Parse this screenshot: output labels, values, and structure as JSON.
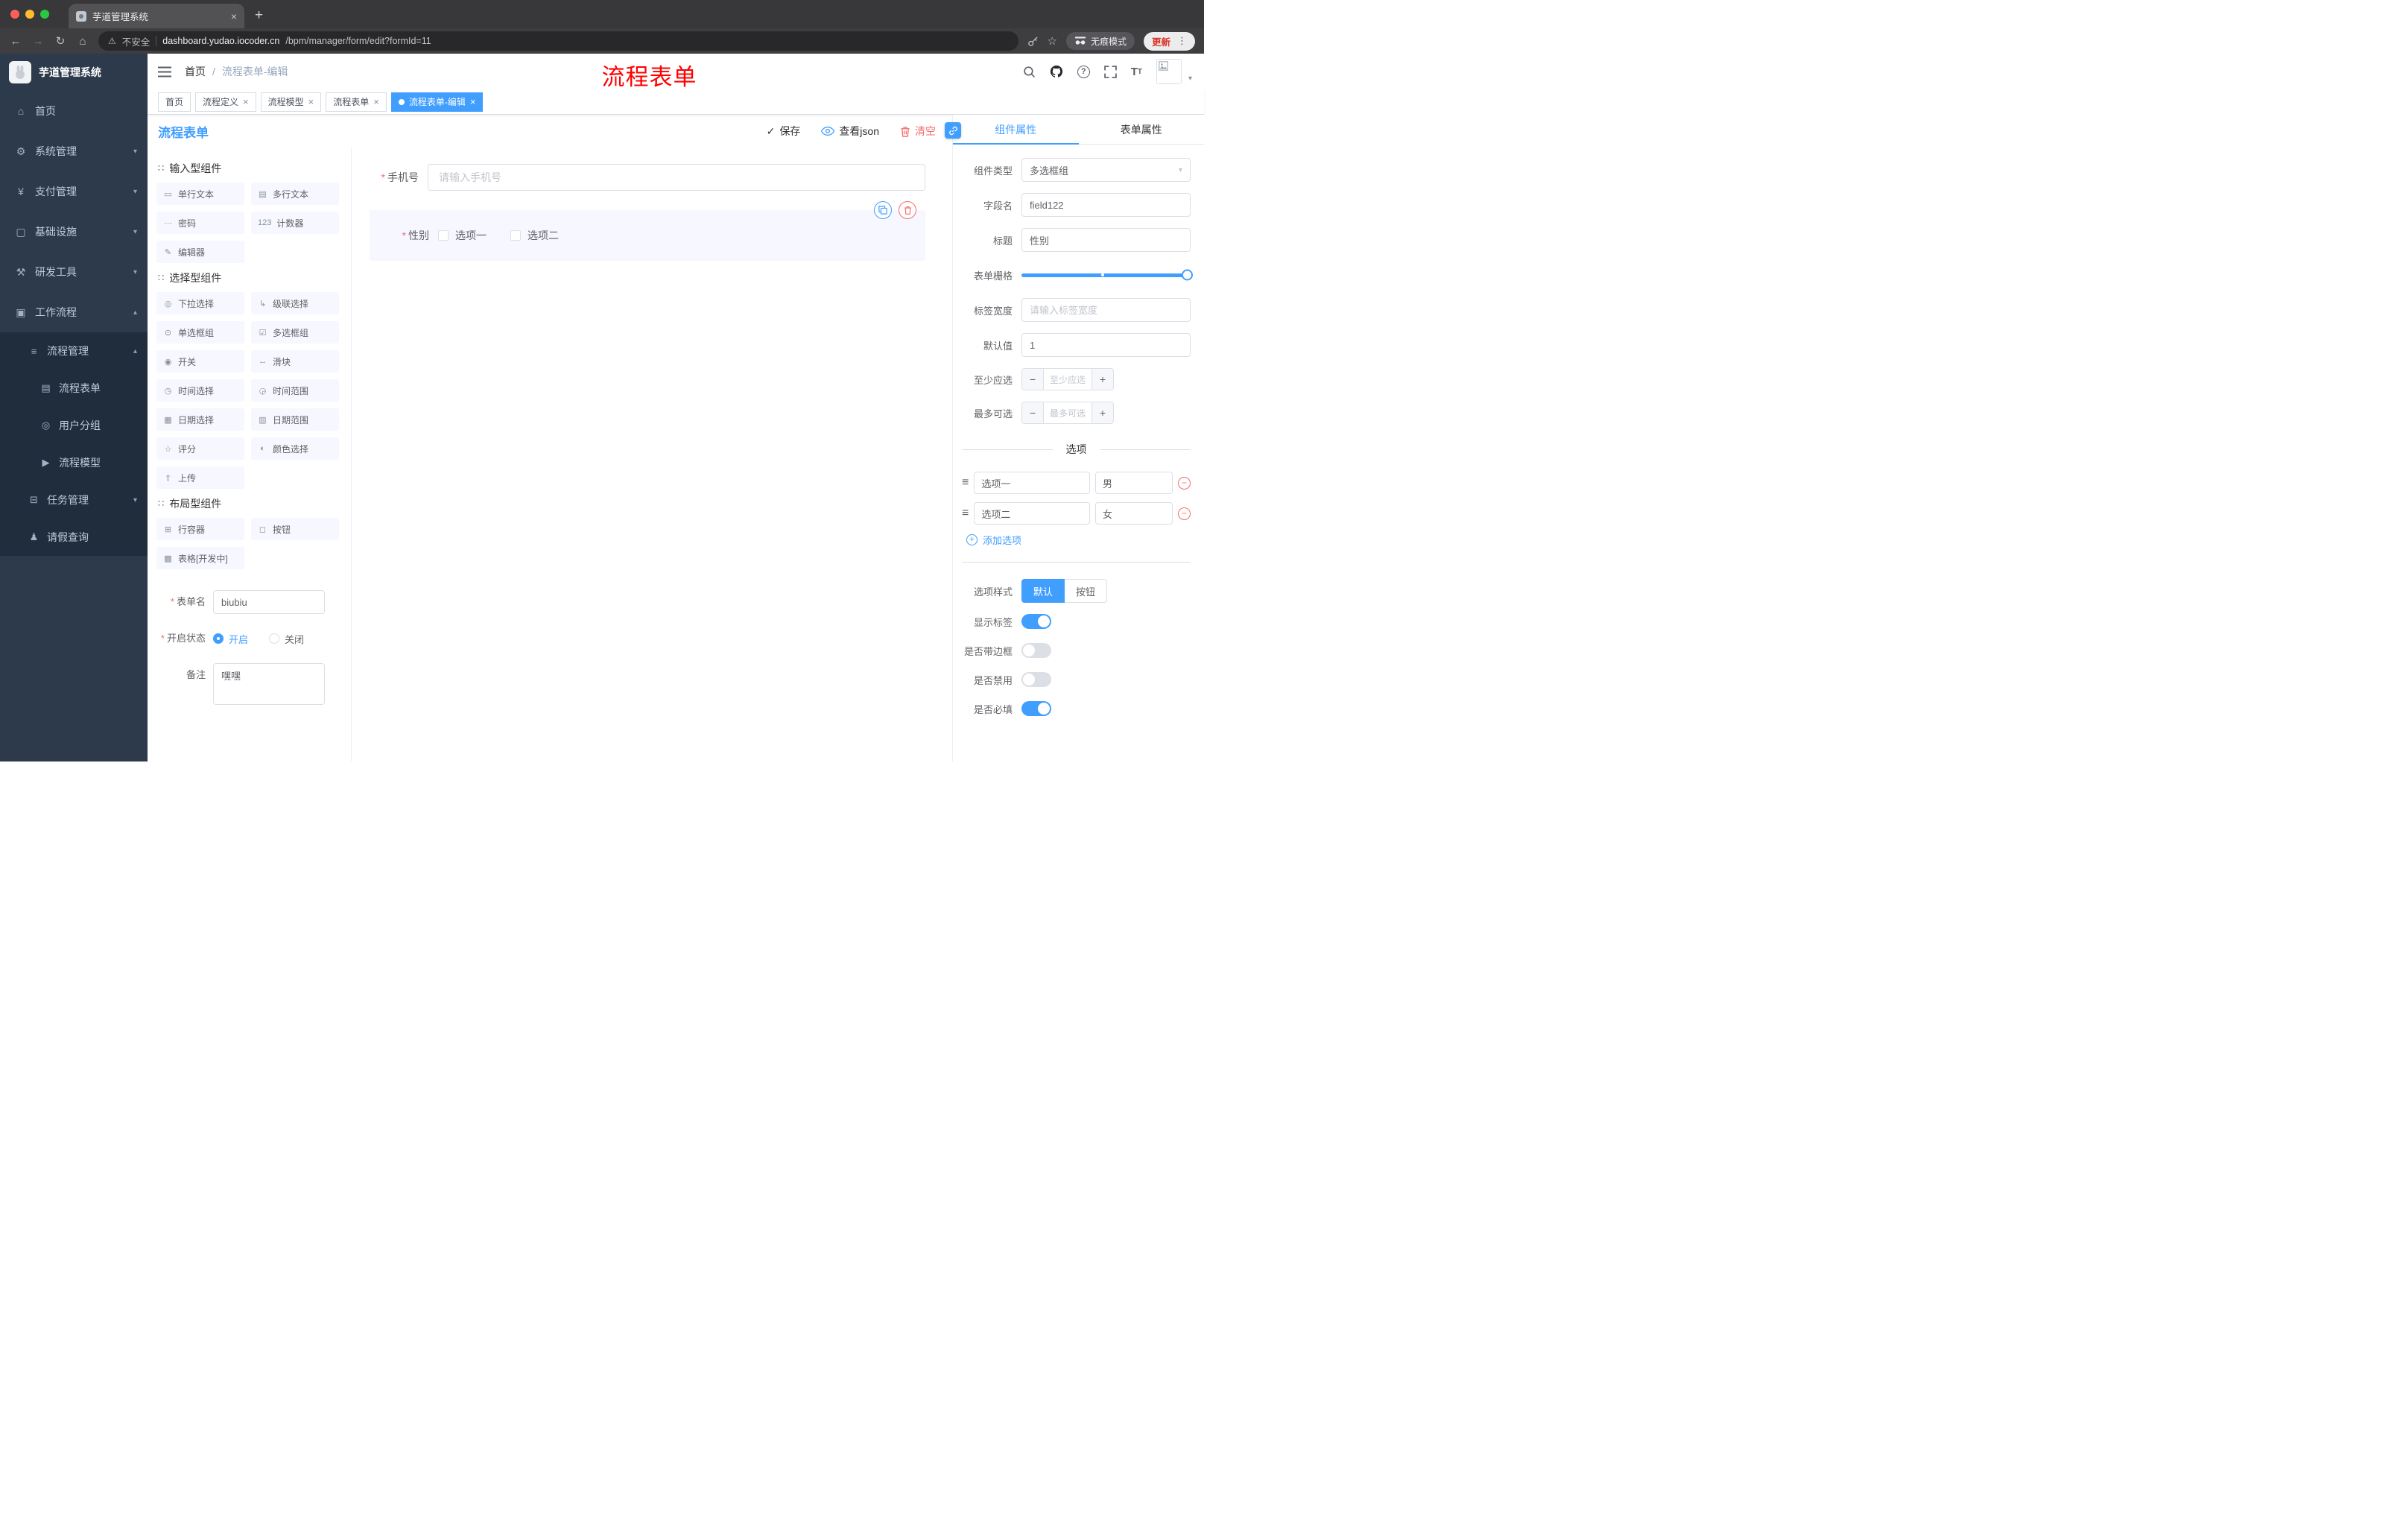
{
  "colors": {
    "primary": "#409eff",
    "danger": "#f56c6c",
    "annotation_red": "#ff0000",
    "sidebar_bg": "#2d3a4b",
    "submenu_bg": "#1f2d3d",
    "active_tag_bg": "#409eff"
  },
  "icons": {
    "required": "*",
    "back": "←",
    "forward": "→",
    "reload": "↻",
    "nav_home": "⌂",
    "warning": "⚠",
    "star": "☆",
    "dots": "⋮",
    "new_tab": "+",
    "close": "×",
    "caret_down": "▾",
    "caret_up": "▴",
    "slash": "/",
    "check": "✓",
    "question": "?",
    "text_size": "T",
    "text_size_small": "T",
    "section_drag": "∷",
    "option_drag": "≡",
    "minus": "−",
    "plus": "+"
  },
  "browser": {
    "tab_title": "芋道管理系统",
    "security_label": "不安全",
    "url_host": "dashboard.yudao.iocoder.cn",
    "url_path": "/bpm/manager/form/edit?formId=11",
    "incognito_label": "无痕模式",
    "update_label": "更新"
  },
  "annotation": "流程表单",
  "sidebar": {
    "logo_title": "芋道管理系统",
    "menu": [
      {
        "label": "首页",
        "glyph": "⌂"
      },
      {
        "label": "系统管理",
        "glyph": "⚙"
      },
      {
        "label": "支付管理",
        "glyph": "¥"
      },
      {
        "label": "基础设施",
        "glyph": "▢"
      },
      {
        "label": "研发工具",
        "glyph": "⚒"
      },
      {
        "label": "工作流程",
        "glyph": "▣"
      }
    ],
    "process_mgmt": {
      "label": "流程管理",
      "glyph": "≡"
    },
    "process_children": [
      {
        "label": "流程表单",
        "glyph": "▤"
      },
      {
        "label": "用户分组",
        "glyph": "◎"
      },
      {
        "label": "流程模型",
        "glyph": "▶"
      }
    ],
    "task_mgmt": {
      "label": "任务管理",
      "glyph": "⊟"
    },
    "leave_query": {
      "label": "请假查询",
      "glyph": "♟"
    }
  },
  "breadcrumb": {
    "root": "首页",
    "current": "流程表单-编辑"
  },
  "tags": [
    {
      "label": "首页"
    },
    {
      "label": "流程定义"
    },
    {
      "label": "流程模型"
    },
    {
      "label": "流程表单"
    },
    {
      "label": "流程表单-编辑"
    }
  ],
  "content": {
    "title": "流程表单",
    "save": "保存",
    "view_json": "查看json",
    "clear": "清空"
  },
  "palette": {
    "sections": [
      {
        "title": "输入型组件",
        "items": [
          {
            "label": "单行文本",
            "glyph": "▭"
          },
          {
            "label": "多行文本",
            "glyph": "▤"
          },
          {
            "label": "密码",
            "glyph": "⋯"
          },
          {
            "label": "计数器",
            "glyph": "123"
          },
          {
            "label": "编辑器",
            "glyph": "✎"
          }
        ]
      },
      {
        "title": "选择型组件",
        "items": [
          {
            "label": "下拉选择",
            "glyph": "◎"
          },
          {
            "label": "级联选择",
            "glyph": "↳"
          },
          {
            "label": "单选框组",
            "glyph": "⊙"
          },
          {
            "label": "多选框组",
            "glyph": "☑"
          },
          {
            "label": "开关",
            "glyph": "◉"
          },
          {
            "label": "滑块",
            "glyph": "↔"
          },
          {
            "label": "时间选择",
            "glyph": "◷"
          },
          {
            "label": "时间范围",
            "glyph": "◶"
          },
          {
            "label": "日期选择",
            "glyph": "▦"
          },
          {
            "label": "日期范围",
            "glyph": "▥"
          },
          {
            "label": "评分",
            "glyph": "☆"
          },
          {
            "label": "颜色选择",
            "glyph": "◐"
          },
          {
            "label": "上传",
            "glyph": "⇧"
          }
        ]
      },
      {
        "title": "布局型组件",
        "items": [
          {
            "label": "行容器",
            "glyph": "⊞"
          },
          {
            "label": "按钮",
            "glyph": "◻"
          },
          {
            "label": "表格[开发中]",
            "glyph": "▩"
          }
        ]
      }
    ]
  },
  "form_settings": {
    "name_label": "表单名",
    "name_value": "biubiu",
    "status_label": "开启状态",
    "status_on": "开启",
    "status_off": "关闭",
    "remark_label": "备注",
    "remark_value": "嘿嘿"
  },
  "canvas": {
    "phone_label": "手机号",
    "phone_placeholder": "请输入手机号",
    "gender_label": "性别",
    "gender_option1": "选项一",
    "gender_option2": "选项二"
  },
  "props": {
    "tab_component": "组件属性",
    "tab_form": "表单属性",
    "component_type_label": "组件类型",
    "component_type_value": "多选框组",
    "field_label": "字段名",
    "field_value": "field122",
    "title_label": "标题",
    "title_value": "性别",
    "grid_label": "表单栅格",
    "label_width_label": "标签宽度",
    "label_width_placeholder": "请输入标签宽度",
    "default_label": "默认值",
    "default_value": "1",
    "min_label": "至少应选",
    "min_placeholder": "至少应选",
    "max_label": "最多可选",
    "max_placeholder": "最多可选",
    "options_title": "选项",
    "options": [
      {
        "label": "选项一",
        "value": "男"
      },
      {
        "label": "选项二",
        "value": "女"
      }
    ],
    "add_option": "添加选项",
    "style_label": "选项样式",
    "style_default": "默认",
    "style_button": "按钮",
    "toggle_show_label": "显示标签",
    "toggle_border": "是否带边框",
    "toggle_disabled": "是否禁用",
    "toggle_required": "是否必填"
  }
}
